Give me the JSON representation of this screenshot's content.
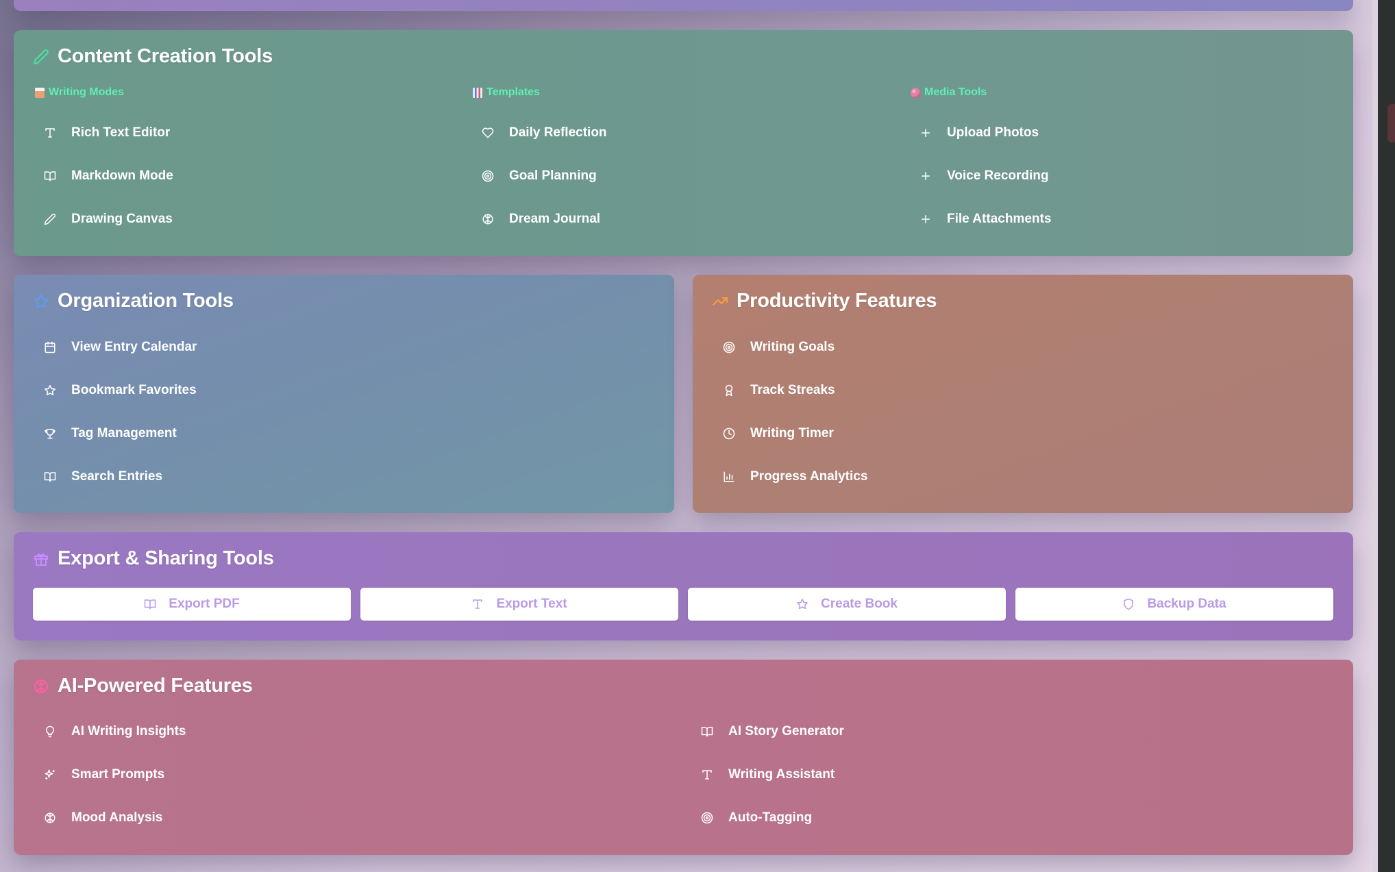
{
  "colors": {
    "content": "#6e9b8e",
    "organization": "#7890ad",
    "productivity": "#b07f72",
    "export": "#9b78c0",
    "ai": "#b8718b",
    "subhead": "#5ef0b4",
    "button_text": "#b99ae6"
  },
  "content_creation": {
    "title": "Content Creation Tools",
    "icon": "pencil-icon",
    "columns": [
      {
        "heading": "Writing Modes",
        "icon": "document-emoji-icon",
        "items": [
          {
            "label": "Rich Text Editor",
            "icon": "type-icon"
          },
          {
            "label": "Markdown Mode",
            "icon": "book-icon"
          },
          {
            "label": "Drawing Canvas",
            "icon": "pencil-icon"
          }
        ]
      },
      {
        "heading": "Templates",
        "icon": "chart-emoji-icon",
        "items": [
          {
            "label": "Daily Reflection",
            "icon": "heart-icon"
          },
          {
            "label": "Goal Planning",
            "icon": "target-icon"
          },
          {
            "label": "Dream Journal",
            "icon": "brain-icon"
          }
        ]
      },
      {
        "heading": "Media Tools",
        "icon": "palette-emoji-icon",
        "items": [
          {
            "label": "Upload Photos",
            "icon": "plus-icon"
          },
          {
            "label": "Voice Recording",
            "icon": "plus-icon"
          },
          {
            "label": "File Attachments",
            "icon": "plus-icon"
          }
        ]
      }
    ]
  },
  "organization": {
    "title": "Organization Tools",
    "icon": "star-icon",
    "items": [
      {
        "label": "View Entry Calendar",
        "icon": "calendar-icon"
      },
      {
        "label": "Bookmark Favorites",
        "icon": "star-icon"
      },
      {
        "label": "Tag Management",
        "icon": "trophy-icon"
      },
      {
        "label": "Search Entries",
        "icon": "book-icon"
      }
    ]
  },
  "productivity": {
    "title": "Productivity Features",
    "icon": "trending-up-icon",
    "items": [
      {
        "label": "Writing Goals",
        "icon": "target-icon"
      },
      {
        "label": "Track Streaks",
        "icon": "award-icon"
      },
      {
        "label": "Writing Timer",
        "icon": "clock-icon"
      },
      {
        "label": "Progress Analytics",
        "icon": "bar-chart-icon"
      }
    ]
  },
  "export": {
    "title": "Export & Sharing Tools",
    "icon": "gift-icon",
    "buttons": [
      {
        "label": "Export PDF",
        "icon": "book-icon"
      },
      {
        "label": "Export Text",
        "icon": "type-icon"
      },
      {
        "label": "Create Book",
        "icon": "star-icon"
      },
      {
        "label": "Backup Data",
        "icon": "shield-icon"
      }
    ]
  },
  "ai": {
    "title": "AI-Powered Features",
    "icon": "brain-icon",
    "columns": [
      {
        "items": [
          {
            "label": "AI Writing Insights",
            "icon": "lightbulb-icon"
          },
          {
            "label": "Smart Prompts",
            "icon": "sparkles-icon"
          },
          {
            "label": "Mood Analysis",
            "icon": "brain-icon"
          }
        ]
      },
      {
        "items": [
          {
            "label": "AI Story Generator",
            "icon": "book-icon"
          },
          {
            "label": "Writing Assistant",
            "icon": "type-icon"
          },
          {
            "label": "Auto-Tagging",
            "icon": "target-icon"
          }
        ]
      }
    ]
  }
}
